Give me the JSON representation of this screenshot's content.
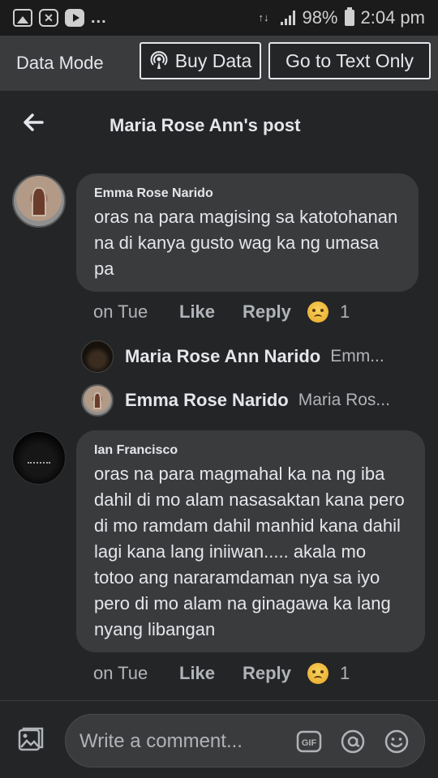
{
  "status_bar": {
    "battery": "98%",
    "time": "2:04 pm",
    "notification_icons": [
      "gallery-icon",
      "capcut-icon",
      "youtube-icon"
    ],
    "more": "..."
  },
  "data_mode": {
    "label": "Data Mode",
    "buy_data": "Buy Data",
    "text_only": "Go to Text Only"
  },
  "header": {
    "title": "Maria Rose Ann's post"
  },
  "comments": [
    {
      "author": "Emma Rose Narido",
      "text": "oras na para magising sa katotohanan na di kanya gusto wag ka ng umasa pa",
      "time": "on Tue",
      "like": "Like",
      "reply": "Reply",
      "reaction_count": "1",
      "replies": [
        {
          "author": "Maria Rose Ann Narido",
          "snippet": "Emm..."
        },
        {
          "author": "Emma Rose Narido",
          "snippet": "Maria Ros..."
        }
      ]
    },
    {
      "author": "Ian Francisco",
      "text": "oras na para magmahal ka na ng iba dahil di mo alam nasasaktan kana pero di mo ramdam dahil manhid kana dahil lagi kana lang iniiwan..... akala mo totoo ang nararamdaman nya sa iyo pero di mo alam na ginagawa ka lang nyang libangan",
      "time": "on Tue",
      "like": "Like",
      "reply": "Reply",
      "reaction_count": "1"
    }
  ],
  "composer": {
    "placeholder": "Write a comment..."
  },
  "colors": {
    "background": "#242526",
    "bubble": "#3a3b3c",
    "text": "#e4e6eb",
    "secondary_text": "#b0b3b8"
  }
}
